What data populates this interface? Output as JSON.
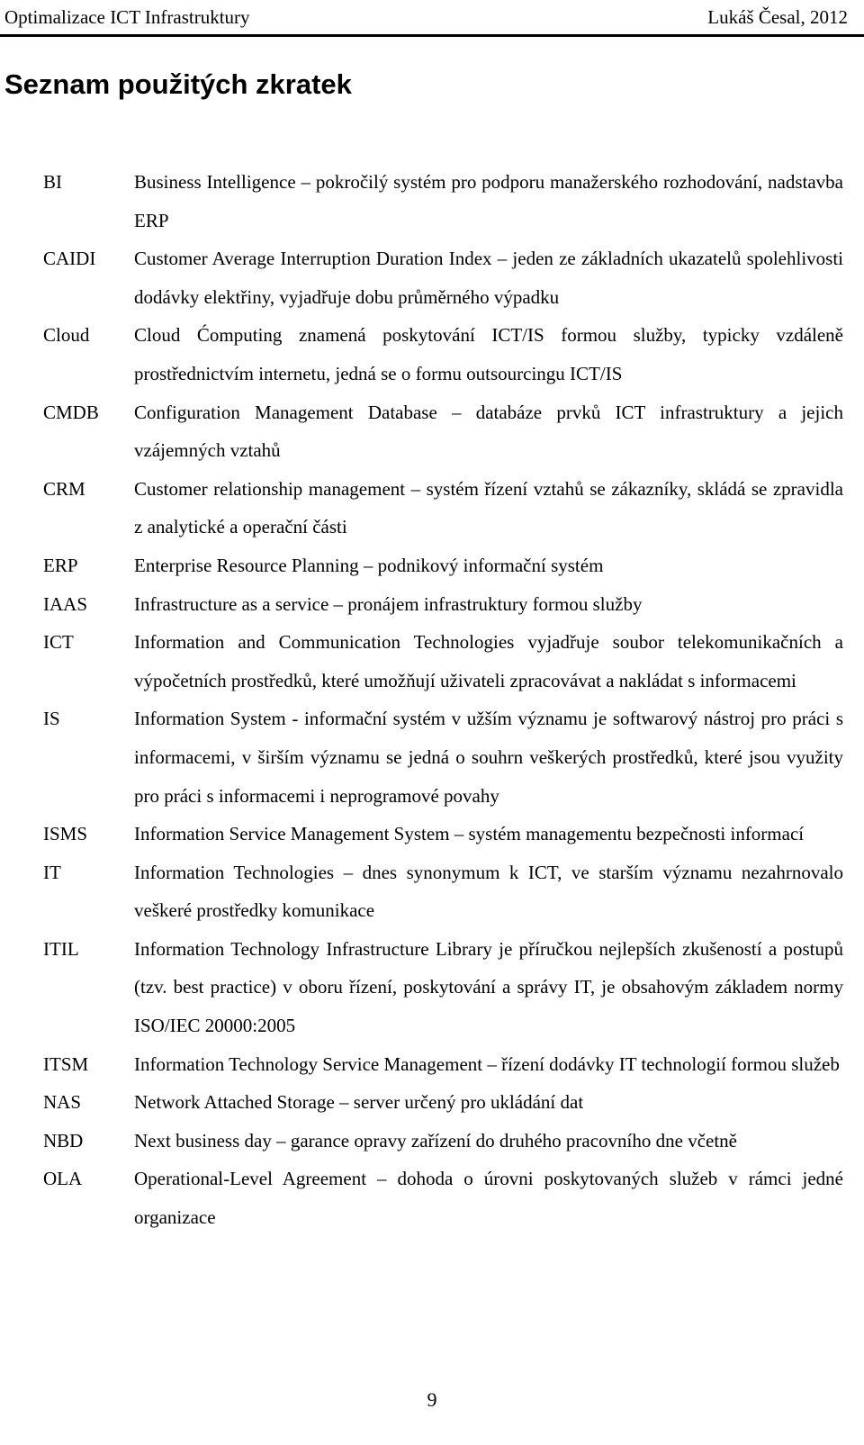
{
  "header": {
    "left": "Optimalizace ICT Infrastruktury",
    "right": "Lukáš Česal, 2012"
  },
  "title": "Seznam použitých zkratek",
  "entries": [
    {
      "abbr": "BI",
      "definition": "Business Intelligence – pokročilý systém pro podporu manažerského rozhodování, nadstavba ERP"
    },
    {
      "abbr": "CAIDI",
      "definition": "Customer Average Interruption Duration Index – jeden ze základních ukazatelů spolehlivosti dodávky elektřiny, vyjadřuje dobu průměrného výpadku"
    },
    {
      "abbr": "Cloud",
      "definition": "Cloud Ćomputing znamená poskytování ICT/IS formou služby, typicky vzdáleně prostřednictvím internetu, jedná se o formu outsourcingu ICT/IS"
    },
    {
      "abbr": "CMDB",
      "definition": "Configuration Management Database – databáze prvků ICT infrastruktury a jejich vzájemných vztahů"
    },
    {
      "abbr": "CRM",
      "definition": "Customer relationship management – systém řízení vztahů se zákazníky, skládá se zpravidla z analytické a operační části"
    },
    {
      "abbr": "ERP",
      "definition": "Enterprise Resource Planning – podnikový informační systém"
    },
    {
      "abbr": "IAAS",
      "definition": "Infrastructure as a service – pronájem infrastruktury formou služby"
    },
    {
      "abbr": "ICT",
      "definition": "Information and Communication Technologies vyjadřuje soubor telekomunikačních a výpočetních prostředků, které umožňují uživateli zpracovávat a nakládat s informacemi"
    },
    {
      "abbr": "IS",
      "definition": "Information System - informační systém v užším významu je softwarový nástroj pro práci s informacemi, v širším významu se jedná o souhrn veškerých prostředků, které jsou využity pro práci s informacemi i neprogramové povahy"
    },
    {
      "abbr": "ISMS",
      "definition": "Information Service Management System – systém managementu bezpečnosti informací"
    },
    {
      "abbr": "IT",
      "definition": "Information Technologies – dnes synonymum k ICT, ve starším významu nezahrnovalo veškeré prostředky komunikace"
    },
    {
      "abbr": "ITIL",
      "definition": "Information Technology Infrastructure Library je příručkou nejlepších zkušeností a postupů (tzv. best practice) v oboru řízení, poskytování a správy IT, je obsahovým základem normy ISO/IEC 20000:2005"
    },
    {
      "abbr": "ITSM",
      "definition": "Information Technology Service Management – řízení dodávky IT technologií formou služeb"
    },
    {
      "abbr": "NAS",
      "definition": "Network Attached Storage – server určený pro ukládání dat"
    },
    {
      "abbr": "NBD",
      "definition": "Next business day – garance opravy zařízení do druhého pracovního dne včetně"
    },
    {
      "abbr": "OLA",
      "definition": "Operational-Level Agreement – dohoda o úrovni poskytovaných služeb v rámci jedné organizace"
    }
  ],
  "page_number": "9"
}
